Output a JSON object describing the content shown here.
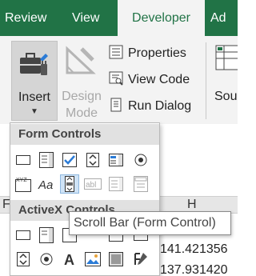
{
  "ribbon": {
    "tabs": [
      {
        "label": "Review"
      },
      {
        "label": "View"
      },
      {
        "label": "Developer"
      },
      {
        "label": "Ad"
      }
    ],
    "insert_label": "Insert",
    "design_label_1": "Design",
    "design_label_2": "Mode",
    "properties_label": "Properties",
    "view_code_label": "View Code",
    "run_dialog_label": "Run Dialog",
    "source_label": "Sou"
  },
  "grid": {
    "col_f": "F",
    "col_h": "H",
    "cell_1": "141.421356",
    "cell_2": "137.931420"
  },
  "dropdown": {
    "form_controls_header": "Form Controls",
    "activex_header": "ActiveX Controls",
    "form_controls_row1": [
      "button-icon",
      "combo-box-icon",
      "check-box-icon",
      "spin-button-icon",
      "list-box-icon",
      "option-button-icon"
    ],
    "form_controls_row2": [
      "group-box-icon",
      "label-icon",
      "scroll-bar-icon",
      "text-field-icon",
      "combo-list-edit-icon",
      "combo-dropdown-edit-icon"
    ],
    "activex_row1": [
      "command-button-icon",
      "combo-box-icon",
      "check-box-icon",
      "list-box-icon",
      "text-box-icon"
    ],
    "activex_row2": [
      "spin-button-icon",
      "option-button-icon",
      "label-icon",
      "image-icon",
      "toggle-button-icon",
      "more-controls-icon"
    ]
  },
  "tooltip": {
    "text": "Scroll Bar (Form Control)"
  },
  "colors": {
    "ribbon_green": "#217346",
    "ribbon_bg": "#f3f3f3",
    "check_blue": "#2b7bd6",
    "hover_blue": "#cfe3f6"
  }
}
